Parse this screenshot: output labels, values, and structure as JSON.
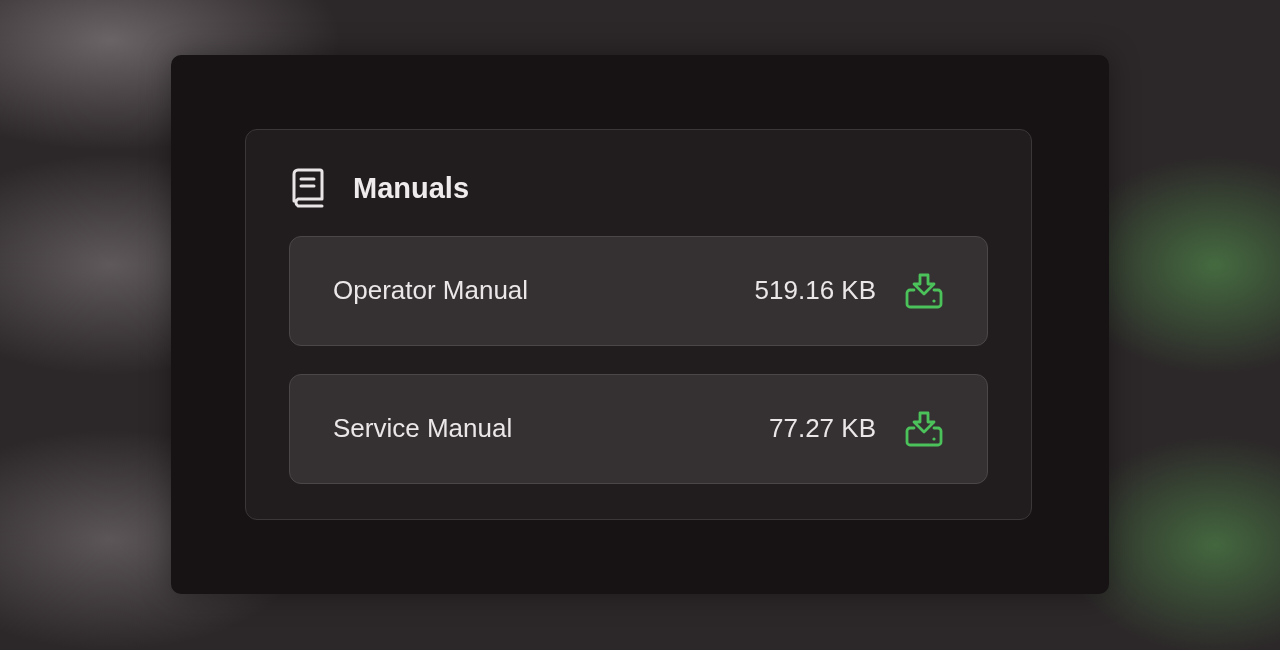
{
  "dialog": {
    "title": "Manuals",
    "files": [
      {
        "name": "Operator Manual",
        "size": "519.16 KB"
      },
      {
        "name": "Service Manual",
        "size": "77.27 KB"
      }
    ]
  }
}
